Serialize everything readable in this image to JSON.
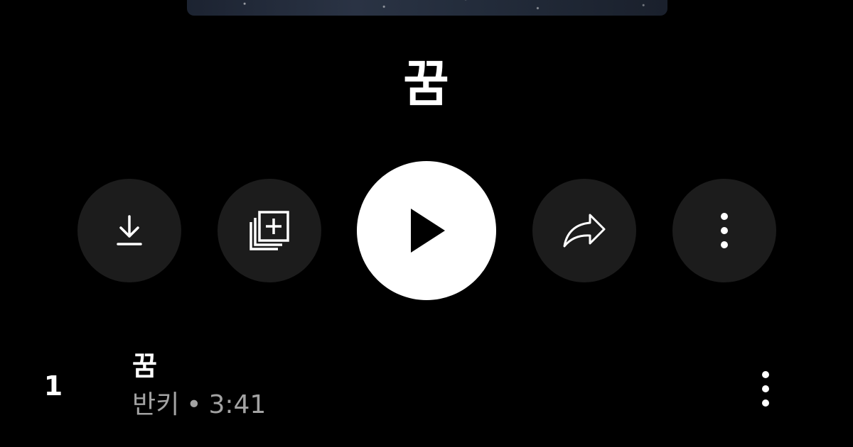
{
  "album": {
    "title": "꿈"
  },
  "actions": {
    "download_icon": "download-icon",
    "save_icon": "add-to-library-icon",
    "play_icon": "play-icon",
    "share_icon": "share-icon",
    "more_icon": "more-vertical-icon"
  },
  "tracks": [
    {
      "number": "1",
      "title": "꿈",
      "artist": "반키",
      "separator": "•",
      "duration": "3:41"
    }
  ],
  "colors": {
    "background": "#000000",
    "button_bg": "#1c1c1c",
    "play_bg": "#ffffff",
    "subtext": "#a3a3a3"
  }
}
